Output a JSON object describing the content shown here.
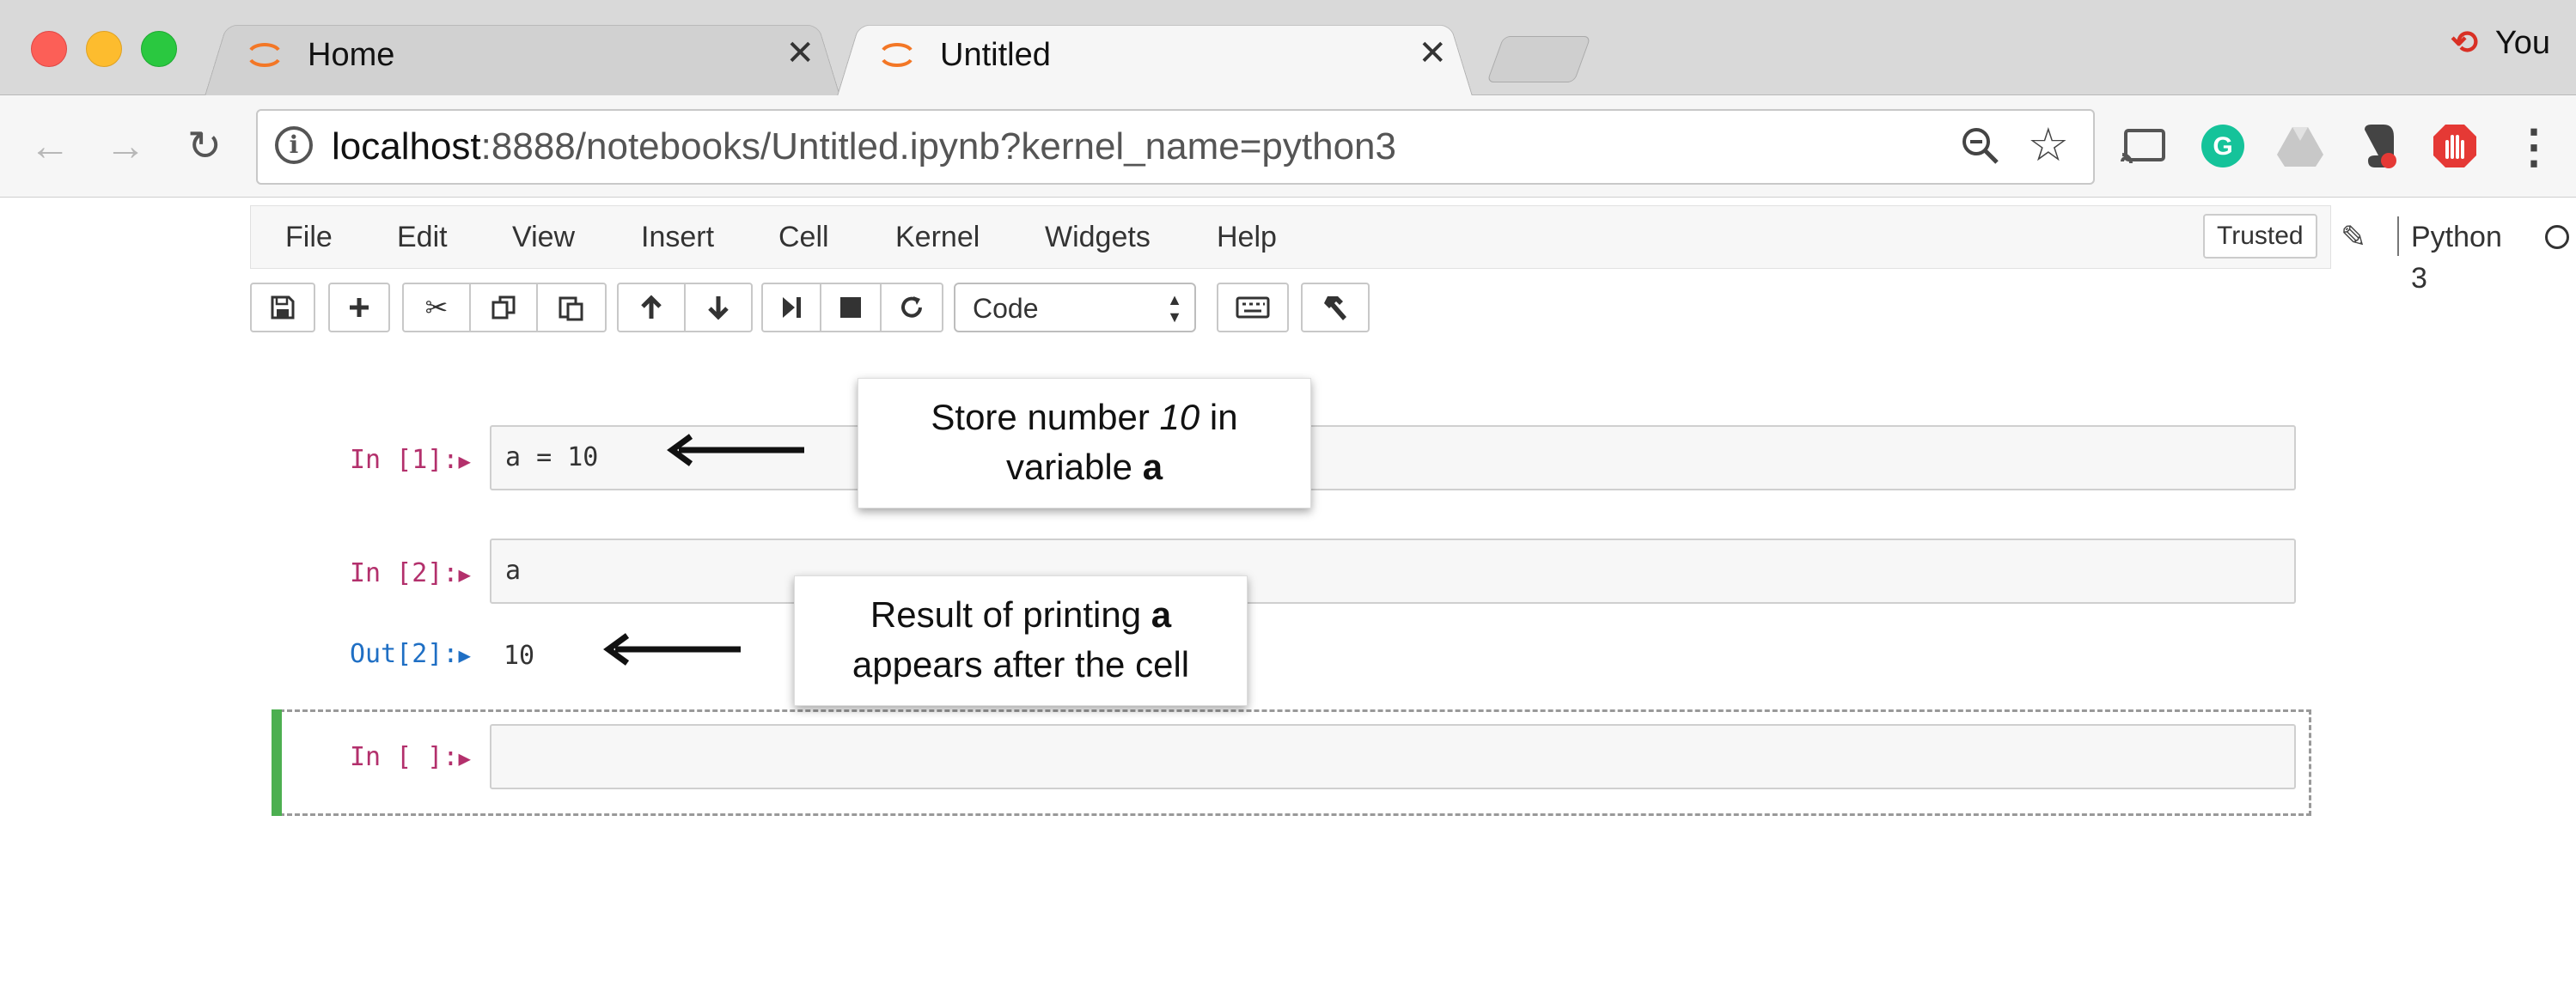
{
  "browser": {
    "tabs": [
      {
        "title": "Home",
        "close": "✕"
      },
      {
        "title": "Untitled",
        "close": "✕"
      }
    ],
    "profile_name": "You",
    "address": {
      "host": "localhost",
      "rest": ":8888/notebooks/Untitled.ipynb?kernel_name=python3"
    }
  },
  "jupyter": {
    "menu": [
      "File",
      "Edit",
      "View",
      "Insert",
      "Cell",
      "Kernel",
      "Widgets",
      "Help"
    ],
    "trusted_label": "Trusted",
    "kernel_name": "Python 3",
    "cell_type": "Code"
  },
  "cells": [
    {
      "prompt": "In [1]:",
      "code": "a = 10"
    },
    {
      "prompt": "In [2]:",
      "code": "a",
      "out_prompt": "Out[2]:",
      "output": "10"
    },
    {
      "prompt": "In [ ]:",
      "code": ""
    }
  ],
  "callouts": {
    "store": {
      "pre": "Store number ",
      "num": "10",
      "mid": " in",
      "line2": "variable ",
      "bold": "a"
    },
    "result": {
      "pre": "Result of printing ",
      "bold": "a",
      "line2": "appears after the cell"
    }
  },
  "colors": {
    "in_prompt": "#b3306c",
    "out_prompt": "#1f6fc4",
    "selected_bar": "#4caf50",
    "jupyter_orange": "#f37726"
  }
}
